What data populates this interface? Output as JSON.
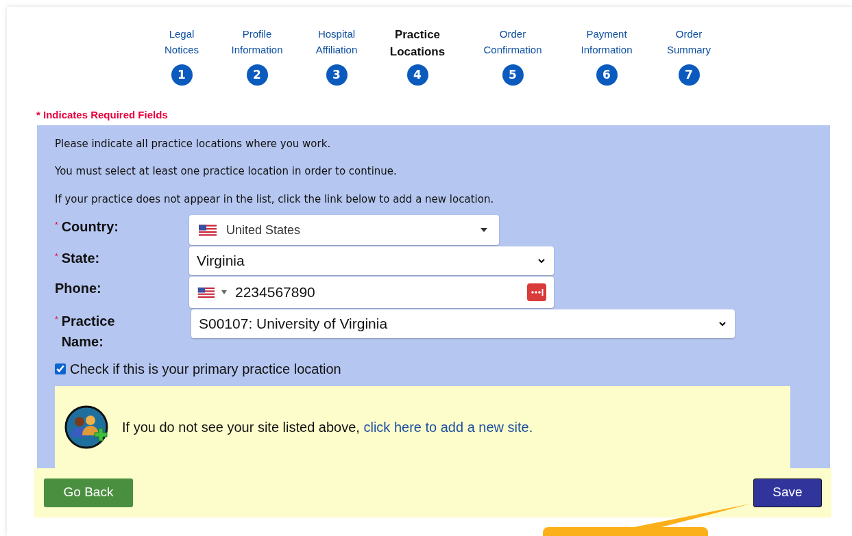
{
  "steps": [
    {
      "label": "Legal\nNotices",
      "number": "1",
      "selected": false
    },
    {
      "label": "Profile\nInformation",
      "number": "2",
      "selected": false
    },
    {
      "label": "Hospital\nAffiliation",
      "number": "3",
      "selected": false
    },
    {
      "label": "Practice\nLocations",
      "number": "4",
      "selected": true
    },
    {
      "label": "Order\nConfirmation",
      "number": "5",
      "selected": false
    },
    {
      "label": "Payment\nInformation",
      "number": "6",
      "selected": false
    },
    {
      "label": "Order\nSummary",
      "number": "7",
      "selected": false
    }
  ],
  "required_note": "* Indicates Required Fields",
  "required_marker": "*",
  "instructions": [
    "Please indicate all practice locations where you work.",
    "You must select at least one practice location in order to continue.",
    "If your practice does not appear in the list, click the link below to add a new location."
  ],
  "fields": [
    {
      "kind": "country",
      "label": "Country:",
      "required": true,
      "value": "United States"
    },
    {
      "kind": "select",
      "label": "State:",
      "required": true,
      "value": "Virginia"
    },
    {
      "kind": "phone",
      "label": "Phone:",
      "required": false,
      "value": "2234567890"
    },
    {
      "kind": "wide-select",
      "label": "Practice Name:",
      "required": true,
      "value": "S00107: University of Virginia"
    }
  ],
  "primary_checkbox": {
    "label": "Check if this is your primary practice location",
    "checked": true
  },
  "add_site": {
    "text": "If you do not see your site listed above,",
    "link": "click here to add a new site."
  },
  "buttons": {
    "back": "Go Back",
    "save": "Save"
  }
}
